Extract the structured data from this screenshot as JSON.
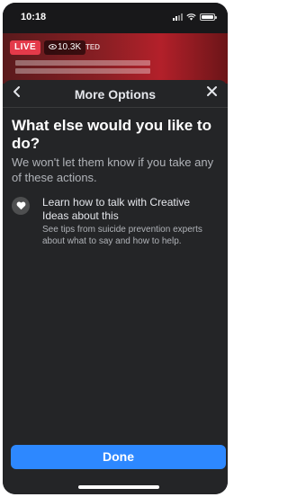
{
  "status_bar": {
    "time": "10:18"
  },
  "video": {
    "live_label": "LIVE",
    "viewer_count": "10.3K",
    "title_fragment": "TED"
  },
  "sheet": {
    "title": "More Options",
    "back_icon": "chevron-left-icon",
    "close_icon": "close-icon",
    "question": "What else would you like to do?",
    "subtext": "We won't let them know if you take any of these actions.",
    "options": [
      {
        "icon": "heart-icon",
        "title": "Learn how to talk with Creative Ideas about this",
        "description": "See tips from suicide prevention experts about what to say and how to help."
      }
    ],
    "done_label": "Done"
  },
  "colors": {
    "accent": "#2d88ff",
    "sheet_bg": "#242527",
    "live": "#e43a4a"
  }
}
